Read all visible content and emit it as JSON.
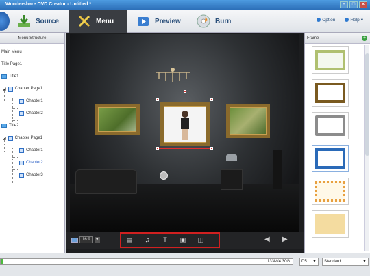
{
  "window": {
    "title": "Wondershare DVD Creator - Untitled *"
  },
  "toolbar": {
    "source_label": "Source",
    "menu_label": "Menu",
    "preview_label": "Preview",
    "burn_label": "Burn",
    "option_label": "Option",
    "help_label": "Help"
  },
  "left_panel": {
    "header": "Menu Structure",
    "nodes": [
      "Main Menu",
      "Title Page1",
      "Title1",
      "Chapter Page1",
      "Chapter1",
      "Chapter2",
      "Title2",
      "Chapter Page1",
      "Chapter1",
      "Chapter2",
      "Chapter3"
    ]
  },
  "canvas_bar": {
    "aspect_ratio": "16:9"
  },
  "right_panel": {
    "header": "Frame"
  },
  "status": {
    "capacity": "133M/4.30G",
    "progress": 0.01,
    "disc_type": "D5",
    "quality": "Standard"
  },
  "colors": {
    "accent": "#2f7ad0",
    "progress_fill": "#4cbc3c",
    "selection": "#d02020"
  }
}
